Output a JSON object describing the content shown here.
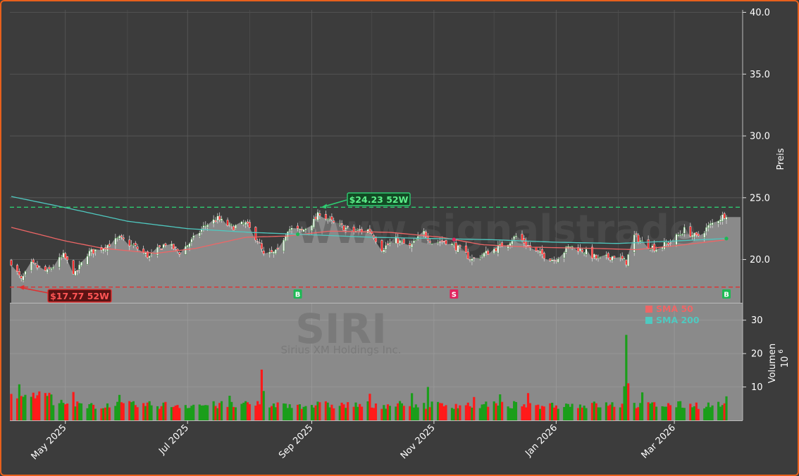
{
  "chart_data": {
    "type": "candlestick",
    "ticker": "SIRI",
    "company": "Sirius XM Holdings Inc.",
    "watermark": "www.signalstrade",
    "price_axis": {
      "label": "Preis",
      "ylim": [
        16.5,
        40.2
      ],
      "ticks": [
        "20.0",
        "25.0",
        "30.0",
        "35.0",
        "40.0"
      ]
    },
    "volume_axis": {
      "label": "Volumen",
      "unit": "10",
      "unit_exp": "6",
      "ylim": [
        0,
        35
      ],
      "ticks": [
        "10",
        "20",
        "30"
      ]
    },
    "x_ticks": [
      "May 2025",
      "Jul 2025",
      "Sep 2025",
      "Nov 2025",
      "Jan 2026",
      "Mar 2026"
    ],
    "x_tick_dates": [
      "2025-05-01",
      "2025-07-01",
      "2025-09-01",
      "2025-11-01",
      "2026-01-01",
      "2026-03-01"
    ],
    "date_range": [
      "2025-04-04",
      "2026-03-27"
    ],
    "close_anchors": [
      [
        "2025-04-04",
        19.8
      ],
      [
        "2025-04-09",
        18.3
      ],
      [
        "2025-04-14",
        19.6
      ],
      [
        "2025-04-22",
        19.0
      ],
      [
        "2025-04-30",
        20.3
      ],
      [
        "2025-05-06",
        18.8
      ],
      [
        "2025-05-12",
        20.5
      ],
      [
        "2025-05-20",
        21.0
      ],
      [
        "2025-05-28",
        21.7
      ],
      [
        "2025-06-05",
        21.0
      ],
      [
        "2025-06-12",
        20.2
      ],
      [
        "2025-06-20",
        21.3
      ],
      [
        "2025-06-27",
        20.6
      ],
      [
        "2025-07-03",
        21.5
      ],
      [
        "2025-07-10",
        22.8
      ],
      [
        "2025-07-16",
        23.3
      ],
      [
        "2025-07-23",
        22.6
      ],
      [
        "2025-07-30",
        22.9
      ],
      [
        "2025-08-05",
        21.6
      ],
      [
        "2025-08-08",
        20.3
      ],
      [
        "2025-08-15",
        20.6
      ],
      [
        "2025-08-20",
        22.5
      ],
      [
        "2025-08-27",
        22.3
      ],
      [
        "2025-09-02",
        23.1
      ],
      [
        "2025-09-05",
        23.8
      ],
      [
        "2025-09-12",
        22.9
      ],
      [
        "2025-09-22",
        22.3
      ],
      [
        "2025-09-30",
        22.4
      ],
      [
        "2025-10-06",
        20.9
      ],
      [
        "2025-10-13",
        21.6
      ],
      [
        "2025-10-20",
        21.0
      ],
      [
        "2025-10-27",
        22.2
      ],
      [
        "2025-10-31",
        21.4
      ],
      [
        "2025-11-07",
        21.5
      ],
      [
        "2025-11-13",
        20.9
      ],
      [
        "2025-11-20",
        20.0
      ],
      [
        "2025-11-28",
        20.6
      ],
      [
        "2025-12-08",
        21.4
      ],
      [
        "2025-12-12",
        21.9
      ],
      [
        "2025-12-22",
        20.6
      ],
      [
        "2025-12-31",
        20.0
      ],
      [
        "2026-01-08",
        21.1
      ],
      [
        "2026-01-15",
        20.7
      ],
      [
        "2026-01-22",
        20.0
      ],
      [
        "2026-01-30",
        20.3
      ],
      [
        "2026-02-05",
        19.8
      ],
      [
        "2026-02-09",
        21.9
      ],
      [
        "2026-02-14",
        21.3
      ],
      [
        "2026-02-20",
        20.9
      ],
      [
        "2026-02-27",
        21.4
      ],
      [
        "2026-03-06",
        22.4
      ],
      [
        "2026-03-12",
        21.8
      ],
      [
        "2026-03-19",
        22.8
      ],
      [
        "2026-03-24",
        23.4
      ],
      [
        "2026-03-27",
        23.7
      ]
    ],
    "sma50_anchors": [
      [
        "2025-04-04",
        22.6
      ],
      [
        "2025-05-01",
        21.5
      ],
      [
        "2025-05-20",
        20.9
      ],
      [
        "2025-06-15",
        20.5
      ],
      [
        "2025-07-05",
        20.9
      ],
      [
        "2025-07-30",
        21.8
      ],
      [
        "2025-08-20",
        21.9
      ],
      [
        "2025-09-10",
        22.3
      ],
      [
        "2025-10-10",
        22.2
      ],
      [
        "2025-11-05",
        21.8
      ],
      [
        "2025-11-25",
        21.2
      ],
      [
        "2025-12-20",
        21.0
      ],
      [
        "2026-01-20",
        20.9
      ],
      [
        "2026-02-10",
        20.8
      ],
      [
        "2026-03-01",
        21.1
      ],
      [
        "2026-03-27",
        21.6
      ]
    ],
    "sma200_anchors": [
      [
        "2025-04-04",
        25.1
      ],
      [
        "2025-05-01",
        24.2
      ],
      [
        "2025-06-01",
        23.1
      ],
      [
        "2025-07-01",
        22.5
      ],
      [
        "2025-08-01",
        22.2
      ],
      [
        "2025-09-01",
        22.0
      ],
      [
        "2025-10-01",
        21.8
      ],
      [
        "2025-11-01",
        21.7
      ],
      [
        "2025-12-01",
        21.6
      ],
      [
        "2026-01-01",
        21.4
      ],
      [
        "2026-02-01",
        21.3
      ],
      [
        "2026-03-01",
        21.5
      ],
      [
        "2026-03-27",
        21.7
      ]
    ],
    "high_52w": {
      "label": "$24.23 52W",
      "value": 24.23,
      "date": "2025-09-05"
    },
    "low_52w": {
      "label": "$17.77 52W",
      "value": 17.77,
      "date": "2025-04-07"
    },
    "signals": [
      {
        "type": "B",
        "date": "2025-08-25"
      },
      {
        "type": "S",
        "date": "2025-11-11"
      },
      {
        "type": "B",
        "date": "2026-03-27"
      }
    ],
    "volume_spikes": [
      {
        "date": "2025-04-08",
        "value": 10.8,
        "up": true
      },
      {
        "date": "2025-05-05",
        "value": 8.5,
        "up": false
      },
      {
        "date": "2025-08-07",
        "value": 15.2,
        "up": false
      },
      {
        "date": "2025-08-08",
        "value": 8.8,
        "up": true
      },
      {
        "date": "2025-10-29",
        "value": 10.0,
        "up": true
      },
      {
        "date": "2026-02-04",
        "value": 10.2,
        "up": true
      },
      {
        "date": "2026-02-05",
        "value": 25.6,
        "up": true
      },
      {
        "date": "2026-02-06",
        "value": 11.1,
        "up": false
      },
      {
        "date": "2026-03-27",
        "value": 7.2,
        "up": true
      }
    ],
    "legend": [
      {
        "name": "SMA 50",
        "color": "#ee6666"
      },
      {
        "name": "SMA 200",
        "color": "#4fc9c0"
      }
    ],
    "legend_position": "upper-right of volume panel",
    "grid": true,
    "colors": {
      "up": "#1a9e1a",
      "down": "#ff1a1a",
      "area": "#8a8a8a",
      "sma50": "#ee6666",
      "sma200": "#4fc9c0",
      "high_line": "#2ecc71",
      "low_line": "#e03030",
      "buy": "#1db954",
      "sell": "#e0245e"
    }
  }
}
